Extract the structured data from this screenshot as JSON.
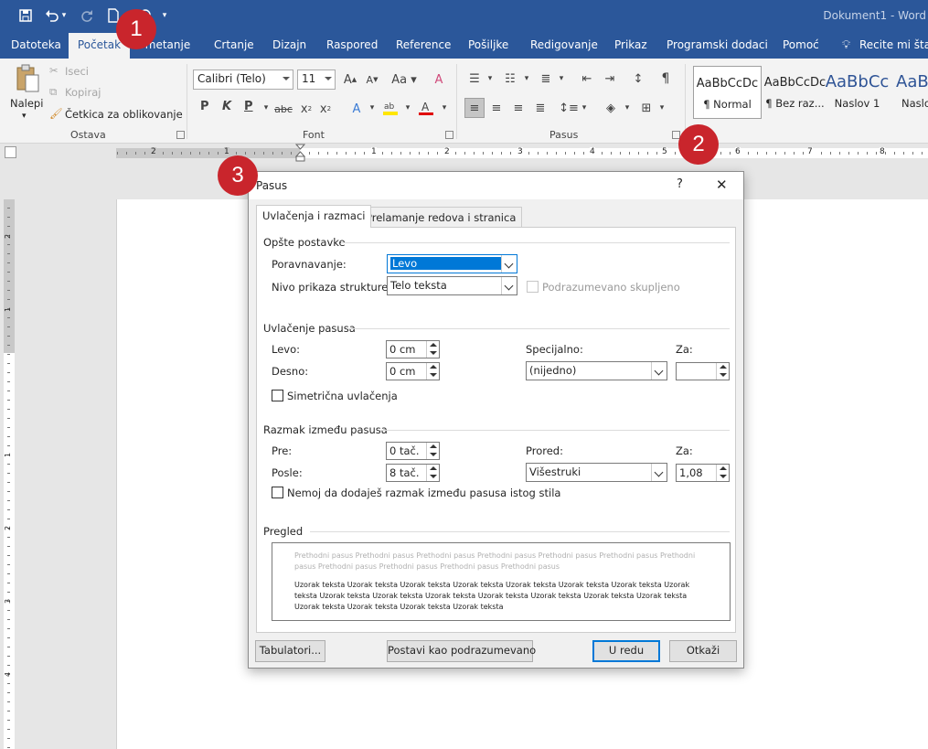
{
  "window": {
    "title": "Dokument1 - Word"
  },
  "ribbon_tabs": [
    {
      "label": "Datoteka"
    },
    {
      "label": "Početak"
    },
    {
      "label": "Umetanje"
    },
    {
      "label": "Crtanje"
    },
    {
      "label": "Dizajn"
    },
    {
      "label": "Raspored"
    },
    {
      "label": "Reference"
    },
    {
      "label": "Pošiljke"
    },
    {
      "label": "Redigovanje"
    },
    {
      "label": "Prikaz"
    },
    {
      "label": "Programski dodaci"
    },
    {
      "label": "Pomoć"
    }
  ],
  "tell_me": "Recite mi šta",
  "clipboard": {
    "paste": "Nalepi",
    "cut": "Iseci",
    "copy": "Kopiraj",
    "format_painter": "Četkica za oblikovanje",
    "group": "Ostava"
  },
  "font": {
    "name": "Calibri (Telo)",
    "size": "11",
    "group": "Font",
    "bold": "P",
    "italic": "K",
    "underline": "P"
  },
  "paragraph": {
    "group": "Pasus"
  },
  "styles": [
    {
      "preview": "AaBbCcDc",
      "name": "¶ Normal"
    },
    {
      "preview": "AaBbCcDc",
      "name": "¶ Bez raz..."
    },
    {
      "preview": "AaBbCc",
      "name": "Naslov 1"
    },
    {
      "preview": "AaBb",
      "name": "Naslov"
    }
  ],
  "ruler": {
    "ticks": [
      "2",
      "1",
      "1",
      "2",
      "3",
      "4",
      "5",
      "6",
      "7",
      "8"
    ]
  },
  "vruler": {
    "ticks": [
      "2",
      "1",
      "1",
      "2",
      "3",
      "4"
    ]
  },
  "badges": [
    "1",
    "2",
    "3"
  ],
  "dialog": {
    "title": "Pasus",
    "help": "?",
    "close": "✕",
    "tabs": [
      "Uvlačenja i razmaci",
      "Prelamanje redova i stranica"
    ],
    "general": {
      "heading": "Opšte postavke",
      "alignment_label": "Poravnavanje:",
      "alignment_value": "Levo",
      "outline_label": "Nivo prikaza strukture:",
      "outline_value": "Telo teksta",
      "collapsed_label": "Podrazumevano skupljeno"
    },
    "indent": {
      "heading": "Uvlačenje pasusa",
      "left_label": "Levo:",
      "left_value": "0 cm",
      "right_label": "Desno:",
      "right_value": "0 cm",
      "special_label": "Specijalno:",
      "special_value": "(nijedno)",
      "by_label": "Za:",
      "by_value": "",
      "mirror_label": "Simetrična uvlačenja"
    },
    "spacing": {
      "heading": "Razmak između pasusa",
      "before_label": "Pre:",
      "before_value": "0 tač.",
      "after_label": "Posle:",
      "after_value": "8 tač.",
      "line_label": "Prored:",
      "line_value": "Višestruki",
      "at_label": "Za:",
      "at_value": "1,08",
      "dont_add_label": "Nemoj da dodaješ razmak između pasusa istog stila"
    },
    "preview": {
      "heading": "Pregled",
      "prev_text": "Prethodni pasus Prethodni pasus Prethodni pasus Prethodni pasus Prethodni pasus Prethodni pasus Prethodni pasus Prethodni pasus Prethodni pasus Prethodni pasus Prethodni pasus",
      "sample_text": "Uzorak teksta Uzorak teksta Uzorak teksta Uzorak teksta Uzorak teksta Uzorak teksta Uzorak teksta Uzorak teksta Uzorak teksta Uzorak teksta Uzorak teksta Uzorak teksta Uzorak teksta Uzorak teksta Uzorak teksta Uzorak teksta Uzorak teksta Uzorak teksta Uzorak teksta"
    },
    "buttons": {
      "tabs": "Tabulatori...",
      "default": "Postavi kao podrazumevano",
      "ok": "U redu",
      "cancel": "Otkaži"
    }
  },
  "colors": {
    "brand": "#2b579a",
    "badge": "#c9252c",
    "selection": "#0078d7",
    "highlight": "#ffe600",
    "font_color": "#e00000"
  }
}
